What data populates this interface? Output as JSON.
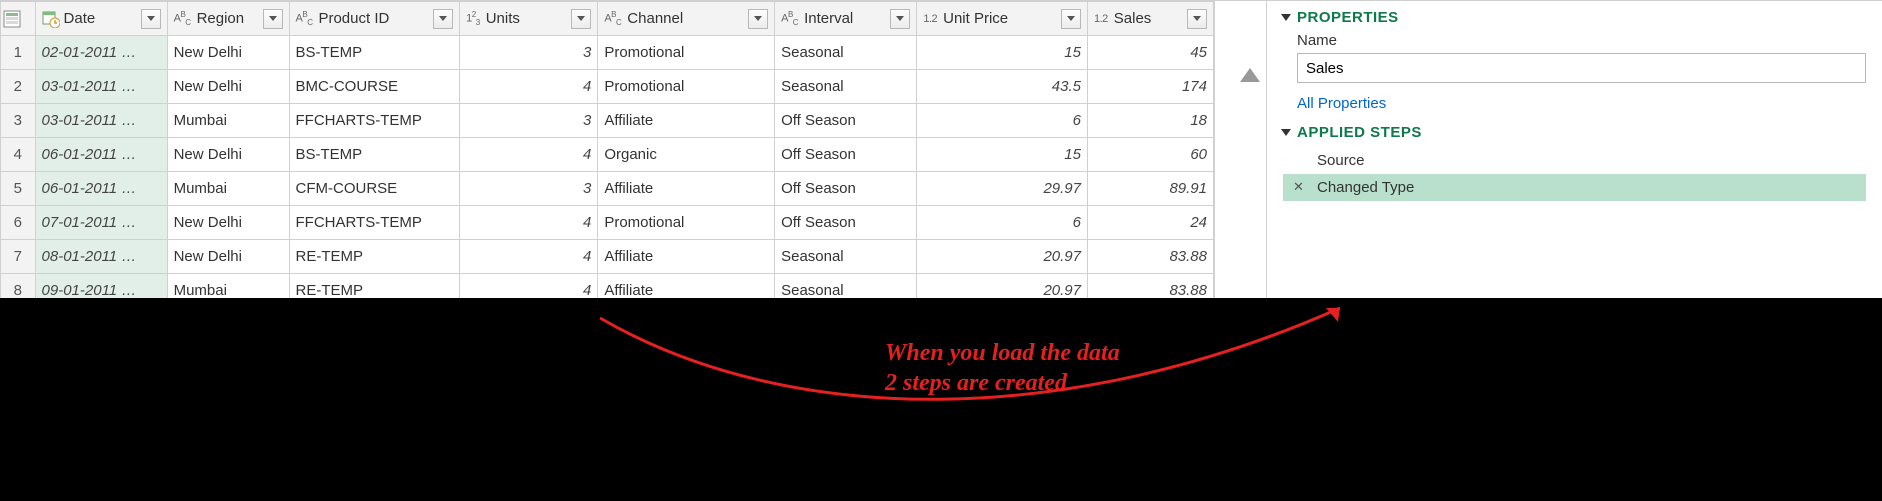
{
  "columns": {
    "date": "Date",
    "region": "Region",
    "product_id": "Product ID",
    "units": "Units",
    "channel": "Channel",
    "interval": "Interval",
    "unit_price": "Unit Price",
    "sales": "Sales"
  },
  "rows": [
    {
      "n": "1",
      "date": "02-01-2011 …",
      "region": "New Delhi",
      "pid": "BS-TEMP",
      "units": "3",
      "chan": "Promotional",
      "intv": "Seasonal",
      "price": "15",
      "sales": "45"
    },
    {
      "n": "2",
      "date": "03-01-2011 …",
      "region": "New Delhi",
      "pid": "BMC-COURSE",
      "units": "4",
      "chan": "Promotional",
      "intv": "Seasonal",
      "price": "43.5",
      "sales": "174"
    },
    {
      "n": "3",
      "date": "03-01-2011 …",
      "region": "Mumbai",
      "pid": "FFCHARTS-TEMP",
      "units": "3",
      "chan": "Affiliate",
      "intv": "Off Season",
      "price": "6",
      "sales": "18"
    },
    {
      "n": "4",
      "date": "06-01-2011 …",
      "region": "New Delhi",
      "pid": "BS-TEMP",
      "units": "4",
      "chan": "Organic",
      "intv": "Off Season",
      "price": "15",
      "sales": "60"
    },
    {
      "n": "5",
      "date": "06-01-2011 …",
      "region": "Mumbai",
      "pid": "CFM-COURSE",
      "units": "3",
      "chan": "Affiliate",
      "intv": "Off Season",
      "price": "29.97",
      "sales": "89.91"
    },
    {
      "n": "6",
      "date": "07-01-2011 …",
      "region": "New Delhi",
      "pid": "FFCHARTS-TEMP",
      "units": "4",
      "chan": "Promotional",
      "intv": "Off Season",
      "price": "6",
      "sales": "24"
    },
    {
      "n": "7",
      "date": "08-01-2011 …",
      "region": "New Delhi",
      "pid": "RE-TEMP",
      "units": "4",
      "chan": "Affiliate",
      "intv": "Seasonal",
      "price": "20.97",
      "sales": "83.88"
    },
    {
      "n": "8",
      "date": "09-01-2011 …",
      "region": "Mumbai",
      "pid": "RE-TEMP",
      "units": "4",
      "chan": "Affiliate",
      "intv": "Seasonal",
      "price": "20.97",
      "sales": "83.88"
    }
  ],
  "panel": {
    "properties_title": "PROPERTIES",
    "name_label": "Name",
    "name_value": "Sales",
    "all_props": "All Properties",
    "steps_title": "APPLIED STEPS",
    "steps": [
      {
        "label": "Source",
        "selected": false
      },
      {
        "label": "Changed Type",
        "selected": true
      }
    ]
  },
  "annotation": "When you load the data\n2 steps are created"
}
